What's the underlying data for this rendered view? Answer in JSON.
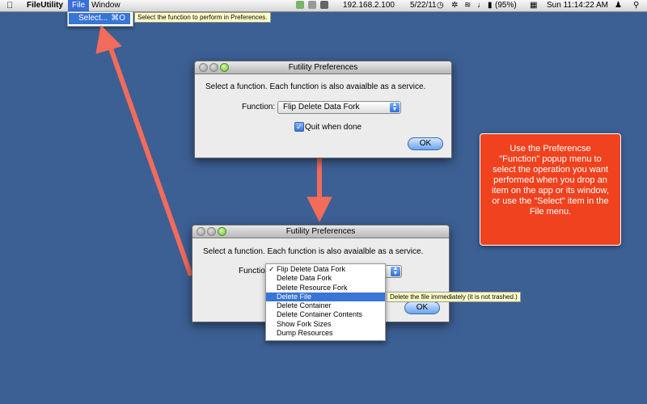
{
  "menubar": {
    "app": "FileUtility",
    "file": "File",
    "window": "Window",
    "ip": "192.168.2.100",
    "date": "5/22/11",
    "battery": "(95%)",
    "clock": "Sun 11:14:22 AM"
  },
  "file_menu": {
    "item_label": "Select...",
    "item_shortcut": "⌘O",
    "tooltip": "Select the function to perform in Preferences."
  },
  "prefs_window_top": {
    "title": "Futility Preferences",
    "description": "Select a function. Each function is also avaialble as a service.",
    "function_label": "Function:",
    "function_value": "Flip Delete Data Fork",
    "quit_label": "Quit when done",
    "quit_checked": true,
    "ok_label": "OK"
  },
  "prefs_window_bottom": {
    "title": "Futility Preferences",
    "description": "Select a function. Each function is also avaialble as a service.",
    "function_label": "Function",
    "ok_label": "OK",
    "popup_items": [
      {
        "label": "Flip Delete Data Fork",
        "checked": true
      },
      {
        "label": "Delete Data Fork",
        "checked": false
      },
      {
        "label": "Delete Resource Fork",
        "checked": false
      },
      {
        "label": "Delete File",
        "selected": true
      },
      {
        "label": "Delete Container",
        "checked": false
      },
      {
        "label": "Delete Container Contents",
        "checked": false
      },
      {
        "label": "Show Fork Sizes",
        "checked": false
      },
      {
        "label": "Dump Resources",
        "checked": false
      }
    ],
    "hover_tooltip": "Delete the file immediately (it is not trashed.)"
  },
  "note": {
    "text": "Use the Preferencse \"Function\" popup menu to select the operation you want performed when you drop an item on the app or its window, or use the \"Select\" item in the File menu."
  },
  "colors": {
    "desktop": "#3c5f94",
    "arrow": "#f26b5b",
    "note_bg": "#f0421e",
    "selection": "#3875d7"
  }
}
